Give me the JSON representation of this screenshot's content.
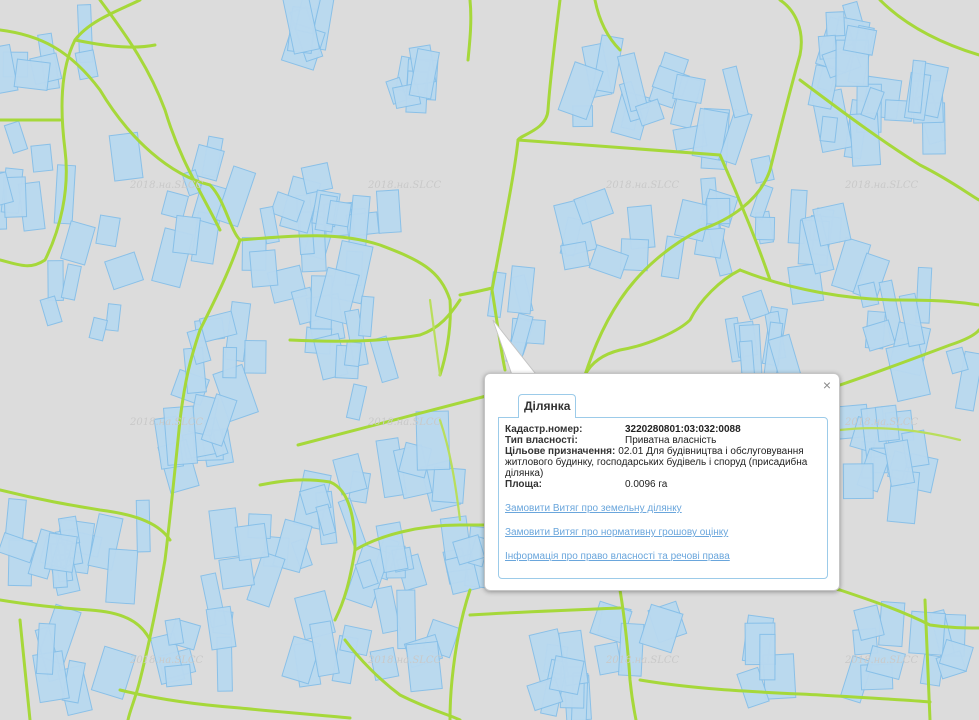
{
  "map": {
    "watermark_text": "2018.на.SLCC",
    "colors": {
      "background": "#dcdcdc",
      "parcel_fill": "#b9d9f0",
      "parcel_stroke": "#86bfe8",
      "road": "#a6d83a"
    }
  },
  "popup": {
    "tab_label": "Ділянка",
    "close_icon": "×",
    "fields": {
      "cadastral_label": "Кадастр.номер:",
      "cadastral_value": "3220280801:03:032:0088",
      "ownership_label": "Тип власності:",
      "ownership_value": "Приватна власність",
      "purpose_label": "Цільове призначення:",
      "purpose_value": "02.01 Для будівництва і обслуговування житлового будинку, господарських будівель і споруд (присадибна ділянка)",
      "area_label": "Площа:",
      "area_value": "0.0096 га"
    },
    "links": {
      "extract_land": "Замовити Витяг про земельну ділянку",
      "extract_valuation": "Замовити Витяг про нормативну грошову оцінку",
      "ownership_info": "Інформація про право власності та речові права"
    }
  }
}
